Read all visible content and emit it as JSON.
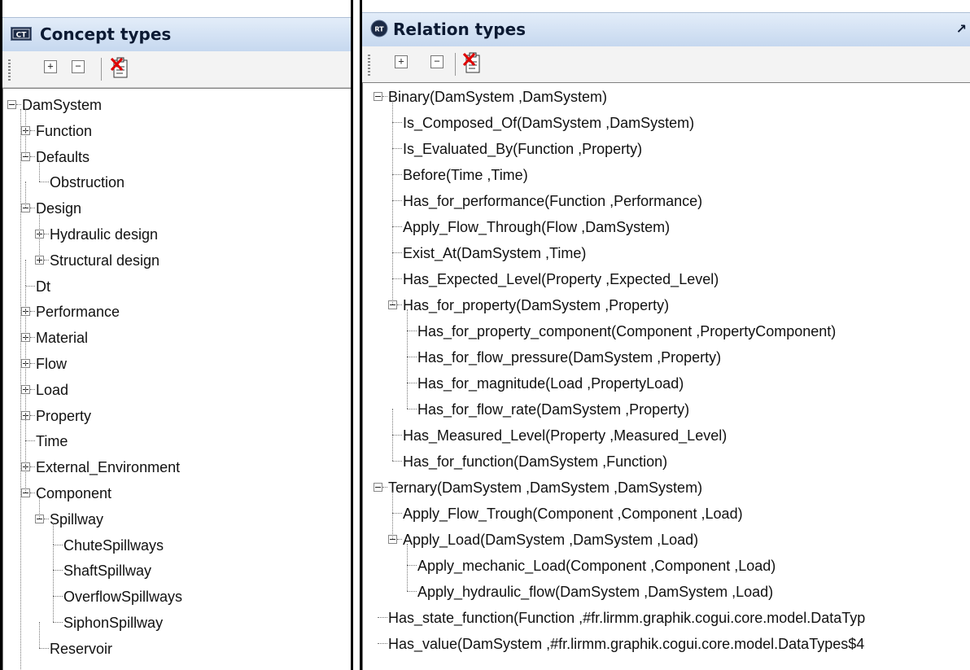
{
  "concept_panel": {
    "title": "Concept types",
    "header_icon": "CT",
    "toolbar": {
      "expand_icon": "plus-box-icon",
      "collapse_icon": "minus-box-icon",
      "delete_icon": "delete-document-icon"
    },
    "tree": [
      "DamSystem",
      "Function",
      "Defaults",
      "Obstruction",
      "Design",
      "Hydraulic design",
      "Structural design",
      "Dt",
      "Performance",
      "Material",
      "Flow",
      "Load",
      "Property",
      "Time",
      "External_Environment",
      "Component",
      "Spillway",
      "ChuteSpillways",
      "ShaftSpillway",
      "OverflowSpillways",
      "SiphonSpillway",
      "Reservoir"
    ]
  },
  "relation_panel": {
    "title": "Relation types",
    "header_icon": "RT",
    "toolbar": {
      "expand_icon": "plus-box-icon",
      "collapse_icon": "minus-box-icon",
      "delete_icon": "delete-document-icon"
    },
    "tree": [
      "Binary(DamSystem ,DamSystem)",
      "Is_Composed_Of(DamSystem ,DamSystem)",
      "Is_Evaluated_By(Function ,Property)",
      "Before(Time ,Time)",
      "Has_for_performance(Function ,Performance)",
      "Apply_Flow_Through(Flow ,DamSystem)",
      "Exist_At(DamSystem ,Time)",
      "Has_Expected_Level(Property ,Expected_Level)",
      "Has_for_property(DamSystem ,Property)",
      "Has_for_property_component(Component ,PropertyComponent)",
      "Has_for_flow_pressure(DamSystem ,Property)",
      "Has_for_magnitude(Load ,PropertyLoad)",
      "Has_for_flow_rate(DamSystem ,Property)",
      "Has_Measured_Level(Property ,Measured_Level)",
      "Has_for_function(DamSystem ,Function)",
      "Ternary(DamSystem ,DamSystem ,DamSystem)",
      "Apply_Flow_Trough(Component ,Component ,Load)",
      "Apply_Load(DamSystem ,DamSystem ,Load)",
      "Apply_mechanic_Load(Component ,Component ,Load)",
      "Apply_hydraulic_flow(DamSystem ,DamSystem ,Load)",
      "Has_state_function(Function ,#fr.lirmm.graphik.cogui.core.model.DataTyp",
      "Has_value(DamSystem ,#fr.lirmm.graphik.cogui.core.model.DataTypes$4"
    ]
  }
}
